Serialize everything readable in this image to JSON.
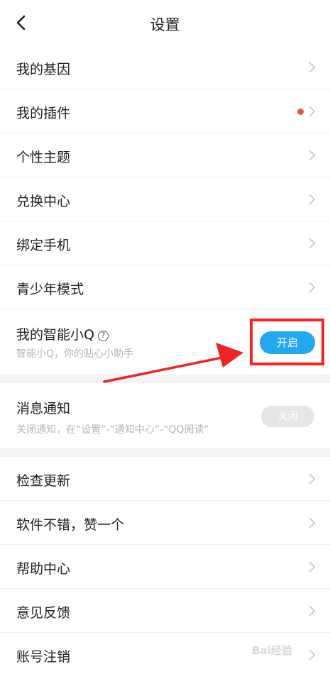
{
  "header": {
    "title": "设置",
    "back_icon": "chevron-left-icon"
  },
  "rows": [
    {
      "label": "我的基因"
    },
    {
      "label": "我的插件",
      "badge": "red-dot"
    },
    {
      "label": "个性主题"
    },
    {
      "label": "兑换中心"
    },
    {
      "label": "绑定手机"
    },
    {
      "label": "青少年模式"
    }
  ],
  "smart_q": {
    "label": "我的智能小Q",
    "help_icon": "question-circle-icon",
    "help_glyph": "?",
    "subtitle": "智能小Q，你的贴心小助手",
    "button_label": "开启"
  },
  "notifications": {
    "label": "消息通知",
    "subtitle": "关闭通知，在“设置”-“通知中心”-“QQ阅读”",
    "button_label": "关闭"
  },
  "bottom_rows": [
    {
      "label": "检查更新"
    },
    {
      "label": "软件不错，赞一个"
    },
    {
      "label": "帮助中心"
    },
    {
      "label": "意见反馈"
    },
    {
      "label": "账号注销"
    }
  ],
  "watermark": "Bai经验",
  "colors": {
    "accent_blue": "#22a8f0",
    "annotation_red": "#ff1f1f",
    "badge_red": "#f04d4d"
  }
}
